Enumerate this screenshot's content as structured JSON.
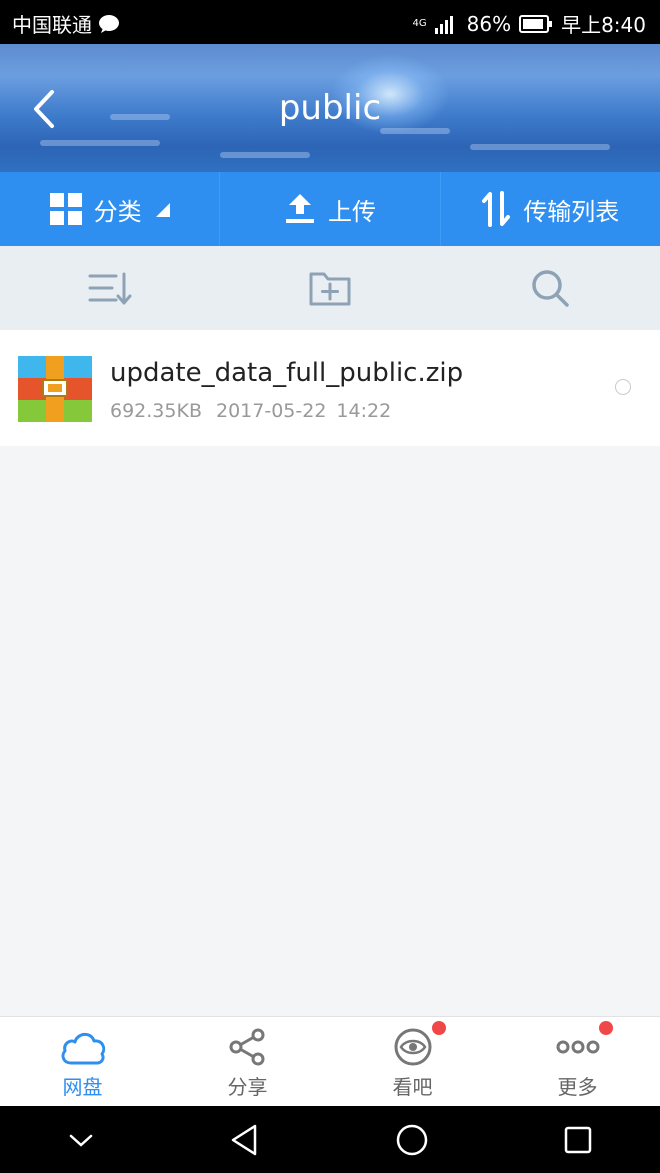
{
  "status_bar": {
    "carrier": "中国联通",
    "network": "4G",
    "battery": "86%",
    "time": "早上8:40"
  },
  "header": {
    "title": "public"
  },
  "toolbar": {
    "category_label": "分类",
    "upload_label": "上传",
    "transfer_label": "传输列表"
  },
  "files": [
    {
      "name": "update_data_full_public.zip",
      "size": "692.35KB",
      "date": "2017-05-22",
      "time": "14:22"
    }
  ],
  "bottom_nav": {
    "items": [
      {
        "label": "网盘",
        "active": true,
        "badge": false
      },
      {
        "label": "分享",
        "active": false,
        "badge": false
      },
      {
        "label": "看吧",
        "active": false,
        "badge": true
      },
      {
        "label": "更多",
        "active": false,
        "badge": true
      }
    ]
  },
  "colors": {
    "accent": "#2f8ff0",
    "badge": "#f04848",
    "toolbar_bg": "#2f8ff0",
    "actions_bg": "#e9eef2"
  }
}
